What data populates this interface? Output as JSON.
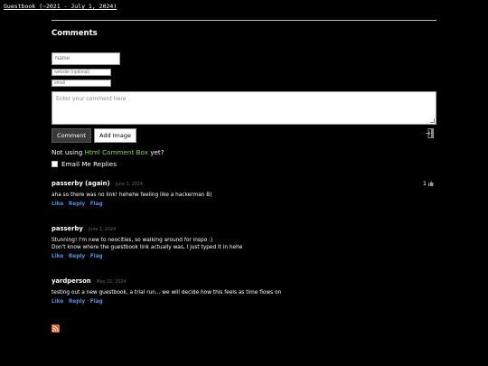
{
  "header": {
    "guestbook_link": "Guestbook (~2021 - July 1, 2024)"
  },
  "section": {
    "title": "Comments"
  },
  "form": {
    "name_placeholder": "Name",
    "website_placeholder": "website (optional)",
    "email_placeholder": "email",
    "comment_placeholder": "Enter your comment here",
    "comment_button": "Comment",
    "add_image_button": "Add Image",
    "promo_prefix": "Not using ",
    "promo_link": "Html Comment Box",
    "promo_suffix": " yet?",
    "email_replies_label": "Email Me Replies"
  },
  "actions": {
    "like": "Like",
    "reply": "Reply",
    "flag": "Flag",
    "sep": " · "
  },
  "comments": [
    {
      "name": "passerby (again)",
      "date": "· June 1, 2024",
      "text": "aha so there was no link! hehehe feeling like a hackerman B)",
      "votes": "1"
    },
    {
      "name": "passerby",
      "date": "· June 1, 2024",
      "text1": "Stunning! I'm new to neocities, so walking around for inspo :)",
      "text2": "Don't know where the guestbook link actually was, I just typed it in hehe"
    },
    {
      "name": "yardperson",
      "date": "· May 22, 2024",
      "text": "testing out a new guestbook, a trial run... we will decide how this feels as time flows on"
    }
  ],
  "colors": {
    "background": "#000000",
    "link": "#4a90e2",
    "promo": "#7ed957",
    "divider": "#bbbbbb"
  },
  "icons": {
    "logout": "logout-icon",
    "thumbs_up": "thumbs-up-icon",
    "rss": "rss-icon"
  }
}
